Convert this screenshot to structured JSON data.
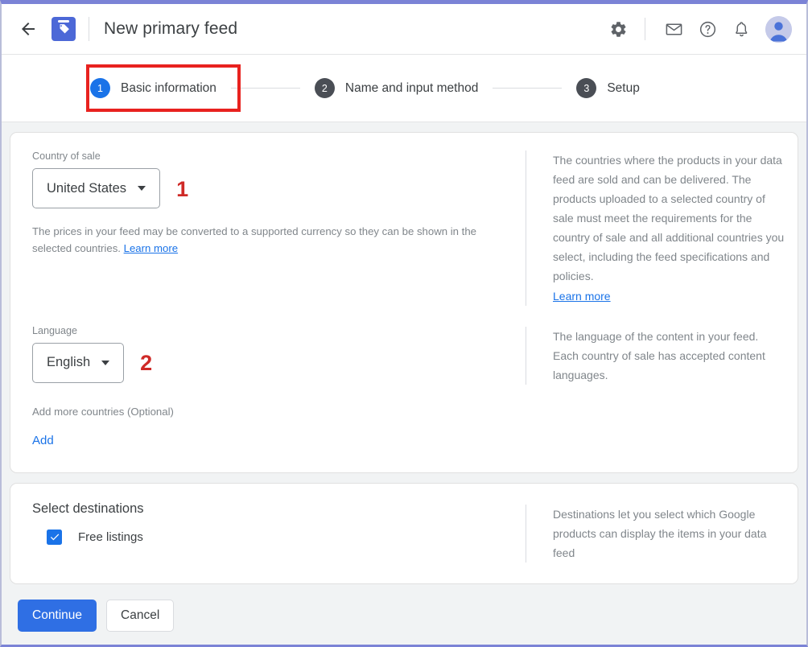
{
  "header": {
    "back_icon": "back-arrow-icon",
    "logo_icon": "merchant-center-tag-icon",
    "title": "New primary feed",
    "icons": [
      "gear-icon",
      "mail-icon",
      "help-icon",
      "bell-icon"
    ],
    "avatar": "user-avatar"
  },
  "stepper": {
    "steps": [
      {
        "number": "1",
        "label": "Basic information",
        "state": "active"
      },
      {
        "number": "2",
        "label": "Name and input method",
        "state": "inactive"
      },
      {
        "number": "3",
        "label": "Setup",
        "state": "inactive"
      }
    ],
    "highlight_color": "#e8221f"
  },
  "basic_info": {
    "country_label": "Country of sale",
    "country_value": "United States",
    "country_annotation": "1",
    "country_helper_prefix": "The prices in your feed may be converted to a supported currency so they can be shown in the selected countries. ",
    "country_helper_link": "Learn more",
    "language_label": "Language",
    "language_value": "English",
    "language_annotation": "2",
    "add_countries_label": "Add more countries (Optional)",
    "add_link": "Add",
    "help_country": "The countries where the products in your data feed are sold and can be delivered. The products uploaded to a selected country of sale must meet the requirements for the country of sale and all additional countries you select, including the feed specifications and policies.",
    "help_country_link": "Learn more",
    "help_language": "The language of the content in your feed. Each country of sale has accepted content languages."
  },
  "destinations": {
    "title": "Select destinations",
    "checkbox_label": "Free listings",
    "checkbox_checked": true,
    "help_text": "Destinations let you select which Google products can display the items in your data feed"
  },
  "footer": {
    "continue_label": "Continue",
    "cancel_label": "Cancel"
  },
  "colors": {
    "accent": "#1a73e8",
    "primary_button": "#2f6fe4",
    "annotation_red": "#cf2a27",
    "window_border": "#7b83d6"
  }
}
